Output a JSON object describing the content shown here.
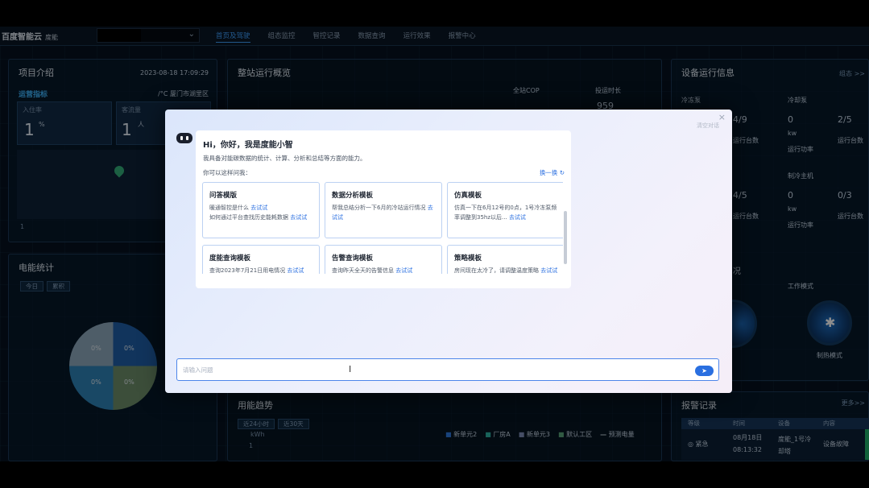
{
  "header": {
    "logo": "百度智能云",
    "logo_sub": "度能",
    "nav": [
      "首页及驾驶",
      "组态监控",
      "智控记录",
      "数据查询",
      "运行效果",
      "报警中心"
    ]
  },
  "project": {
    "title": "项目介绍",
    "datetime": "2023-08-18 17:09:29",
    "subhead": "运营指标",
    "location": "/°C  厦门市湖里区",
    "occupancy_label": "入住率",
    "occupancy_value": "1",
    "occupancy_unit": "%",
    "guests_label": "客流量",
    "guests_value": "1",
    "guests_unit": "人",
    "footnote": "1"
  },
  "energy": {
    "title": "电能统计",
    "tabs": [
      "今日",
      "累积"
    ],
    "slices": [
      "0%",
      "0%",
      "0%",
      "0%"
    ]
  },
  "overview": {
    "title": "整站运行概览",
    "cop_label": "全站COP",
    "hours_label": "投运时长",
    "hours_value": "959"
  },
  "devices": {
    "title": "设备运行信息",
    "more": "组态 >>",
    "cold_pump": "冷冻泵",
    "cool_pump": "冷却泵",
    "cold_host": "制冷主机",
    "ratio1": "4/9",
    "ratio2": "2/5",
    "ratio3": "4/5",
    "ratio4": "0/3",
    "run_units": "运行台数",
    "run_power": "运行功率",
    "zero": "0",
    "kw": "kw",
    "mode_label": "工作模式",
    "mode_value": "制热模式",
    "partial": "况"
  },
  "trend": {
    "title": "用能趋势",
    "tabs": [
      "近24小时",
      "近30天"
    ],
    "unit": "kWh",
    "axis": "1",
    "legend": [
      "新单元2",
      "厂房A",
      "新单元3",
      "默认工区",
      "预测电量"
    ]
  },
  "alarms": {
    "title": "报警记录",
    "more": "更多>>",
    "cols": [
      "等级",
      "时间",
      "设备",
      "内容"
    ],
    "level": "紧急",
    "date": "08月18日",
    "time": "08:13:32",
    "device": "度能_1号冷却塔",
    "content": "设备故障"
  },
  "assistant": {
    "close": "×",
    "clear": "清空对话",
    "greeting": "Hi，你好，我是度能小智",
    "intro": "我具备对能碳数据的统计、计算、分析和总结等方面的能力。",
    "ask": "你可以这样问我：",
    "swap": "换一换",
    "try": "去试试",
    "templates": [
      {
        "title": "问答模版",
        "l1": "暖通智控是什么",
        "l2": "如何通过平台查找历史能耗数据"
      },
      {
        "title": "数据分析模板",
        "l1": "帮我总结分析一下6月的冷站运行情况"
      },
      {
        "title": "仿真模板",
        "l1": "仿真一下在6月12号的0点，1号冷冻泵频率调整到35hz以后..."
      },
      {
        "title": "度能查询模板",
        "l1": "查询2023年7月21日用电情况"
      },
      {
        "title": "告警查询模板",
        "l1": "查询昨天全天的告警信息"
      },
      {
        "title": "策略模板",
        "l1": "房间现在太冷了，请调整温度策略"
      }
    ],
    "placeholder": "请输入问题",
    "send": "➤"
  }
}
